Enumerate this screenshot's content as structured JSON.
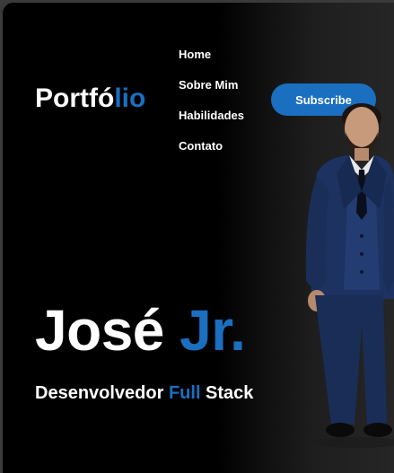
{
  "header": {
    "logo_main": "Portfó",
    "logo_accent": "lio",
    "nav": [
      {
        "label": "Home"
      },
      {
        "label": "Sobre Mim"
      },
      {
        "label": "Habilidades"
      },
      {
        "label": "Contato"
      }
    ],
    "subscribe_label": "Subscribe"
  },
  "hero": {
    "name_main": "José ",
    "name_accent": "Jr.",
    "subtitle_start": "Desenvolvedor ",
    "subtitle_accent": "Full",
    "subtitle_end": " Stack"
  },
  "colors": {
    "accent": "#1a6fc0",
    "background": "#000000",
    "text": "#ffffff"
  },
  "images": {
    "portrait": "man-in-navy-suit-portrait"
  }
}
